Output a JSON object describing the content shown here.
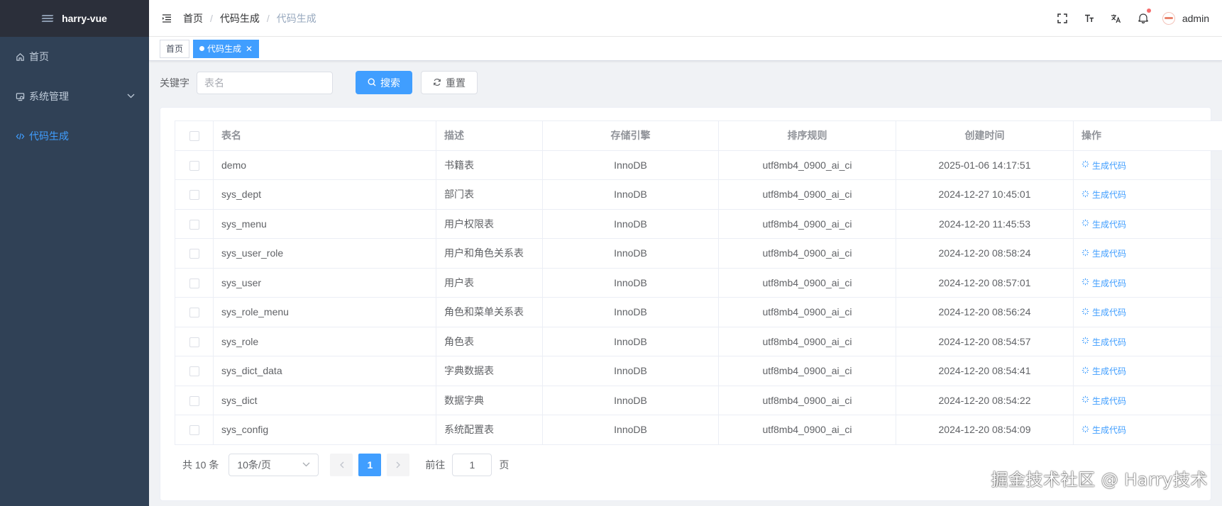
{
  "sidebar": {
    "app_title": "harry-vue",
    "items": [
      {
        "label": "首页"
      },
      {
        "label": "系统管理"
      },
      {
        "label": "代码生成"
      }
    ]
  },
  "header": {
    "breadcrumb": [
      "首页",
      "代码生成",
      "代码生成"
    ],
    "separator": "/",
    "username": "admin"
  },
  "tags": [
    {
      "label": "首页"
    },
    {
      "label": "代码生成"
    }
  ],
  "search": {
    "label": "关键字",
    "placeholder": "表名",
    "search_button": "搜索",
    "reset_button": "重置"
  },
  "table": {
    "columns": [
      "表名",
      "描述",
      "存储引擎",
      "排序规则",
      "创建时间",
      "操作"
    ],
    "rows": [
      {
        "name": "demo",
        "desc": "书籍表",
        "engine": "InnoDB",
        "collation": "utf8mb4_0900_ai_ci",
        "created": "2025-01-06 14:17:51",
        "action": "生成代码"
      },
      {
        "name": "sys_dept",
        "desc": "部门表",
        "engine": "InnoDB",
        "collation": "utf8mb4_0900_ai_ci",
        "created": "2024-12-27 10:45:01",
        "action": "生成代码"
      },
      {
        "name": "sys_menu",
        "desc": "用户权限表",
        "engine": "InnoDB",
        "collation": "utf8mb4_0900_ai_ci",
        "created": "2024-12-20 11:45:53",
        "action": "生成代码"
      },
      {
        "name": "sys_user_role",
        "desc": "用户和角色关系表",
        "engine": "InnoDB",
        "collation": "utf8mb4_0900_ai_ci",
        "created": "2024-12-20 08:58:24",
        "action": "生成代码"
      },
      {
        "name": "sys_user",
        "desc": "用户表",
        "engine": "InnoDB",
        "collation": "utf8mb4_0900_ai_ci",
        "created": "2024-12-20 08:57:01",
        "action": "生成代码"
      },
      {
        "name": "sys_role_menu",
        "desc": "角色和菜单关系表",
        "engine": "InnoDB",
        "collation": "utf8mb4_0900_ai_ci",
        "created": "2024-12-20 08:56:24",
        "action": "生成代码"
      },
      {
        "name": "sys_role",
        "desc": "角色表",
        "engine": "InnoDB",
        "collation": "utf8mb4_0900_ai_ci",
        "created": "2024-12-20 08:54:57",
        "action": "生成代码"
      },
      {
        "name": "sys_dict_data",
        "desc": "字典数据表",
        "engine": "InnoDB",
        "collation": "utf8mb4_0900_ai_ci",
        "created": "2024-12-20 08:54:41",
        "action": "生成代码"
      },
      {
        "name": "sys_dict",
        "desc": "数据字典",
        "engine": "InnoDB",
        "collation": "utf8mb4_0900_ai_ci",
        "created": "2024-12-20 08:54:22",
        "action": "生成代码"
      },
      {
        "name": "sys_config",
        "desc": "系统配置表",
        "engine": "InnoDB",
        "collation": "utf8mb4_0900_ai_ci",
        "created": "2024-12-20 08:54:09",
        "action": "生成代码"
      }
    ]
  },
  "pagination": {
    "total_text": "共 10 条",
    "page_size": "10条/页",
    "current_page": "1",
    "goto_label": "前往",
    "goto_value": "1",
    "goto_suffix": "页"
  },
  "watermark": "掘金技术社区 @ Harry技术",
  "icons": {
    "home": "home-icon",
    "system": "monitor-icon",
    "code": "code-icon",
    "fullscreen": "fullscreen-icon",
    "font_size": "font-size-icon",
    "language": "translate-icon",
    "bell": "bell-icon"
  },
  "colors": {
    "primary": "#409eff",
    "sidebar_bg": "#304156",
    "logo_bg": "#2b2f3a",
    "badge": "#f56c6c"
  }
}
